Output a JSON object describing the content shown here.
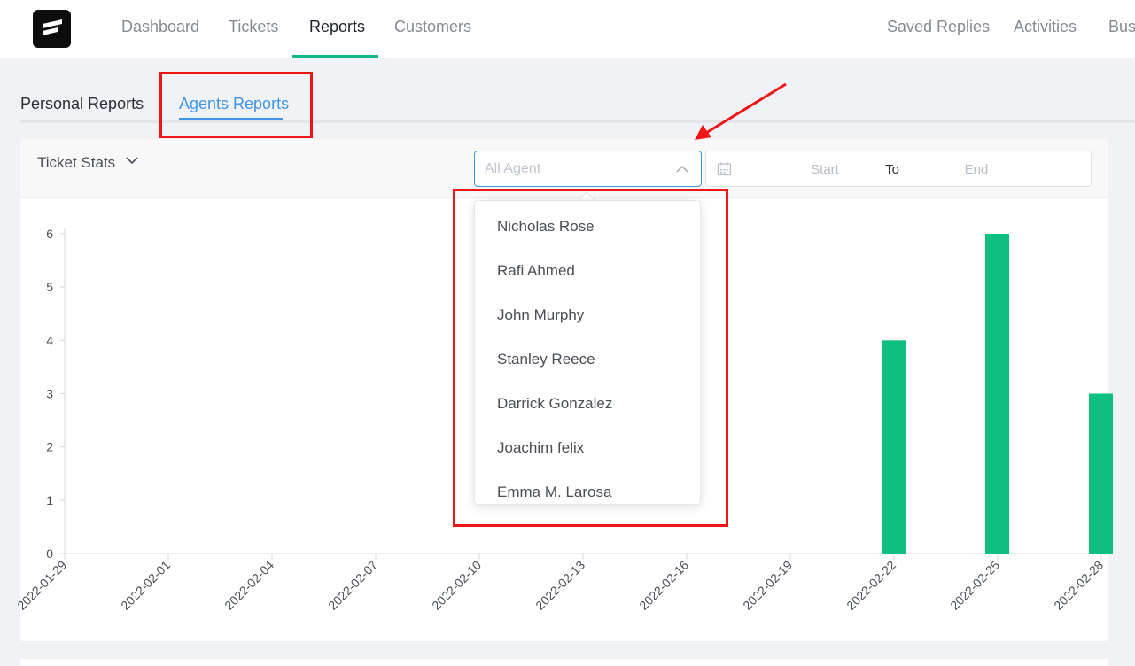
{
  "nav": {
    "items": [
      "Dashboard",
      "Tickets",
      "Reports",
      "Customers"
    ],
    "right_items": [
      "Saved Replies",
      "Activities",
      "Busi"
    ]
  },
  "subtabs": [
    "Personal Reports",
    "Agents Reports"
  ],
  "stats": {
    "label": "Ticket Stats"
  },
  "agent_select": {
    "placeholder": "All Agent"
  },
  "date_range": {
    "start": "Start",
    "separator": "To",
    "end": "End"
  },
  "dropdown": {
    "options": [
      "Nicholas Rose",
      "Rafi Ahmed",
      "John Murphy",
      "Stanley Reece",
      "Darrick Gonzalez",
      "Joachim felix",
      "Emma M. Larosa"
    ]
  },
  "colors": {
    "bar": "#0fbf80",
    "accent": "#3f94e3",
    "nav_active": "#16b98a",
    "highlight": "#f11616"
  },
  "chart_data": {
    "type": "bar",
    "categories": [
      "2022-01-29",
      "2022-01-30",
      "2022-01-31",
      "2022-02-01",
      "2022-02-02",
      "2022-02-03",
      "2022-02-04",
      "2022-02-05",
      "2022-02-06",
      "2022-02-07",
      "2022-02-08",
      "2022-02-09",
      "2022-02-10",
      "2022-02-11",
      "2022-02-12",
      "2022-02-13",
      "2022-02-14",
      "2022-02-15",
      "2022-02-16",
      "2022-02-17",
      "2022-02-18",
      "2022-02-19",
      "2022-02-20",
      "2022-02-21",
      "2022-02-22",
      "2022-02-23",
      "2022-02-24",
      "2022-02-25",
      "2022-02-26",
      "2022-02-27",
      "2022-02-28"
    ],
    "values": [
      0,
      0,
      0,
      0,
      0,
      0,
      0,
      0,
      0,
      0,
      0,
      0,
      0,
      0,
      0,
      0,
      0,
      0,
      0,
      0,
      0,
      0,
      0,
      0,
      4,
      0,
      0,
      6,
      0,
      0,
      3
    ],
    "tick_labels": [
      "2022-01-29",
      "2022-02-01",
      "2022-02-04",
      "2022-02-07",
      "2022-02-10",
      "2022-02-13",
      "2022-02-16",
      "2022-02-19",
      "2022-02-22",
      "2022-02-25",
      "2022-02-28"
    ],
    "y_ticks": [
      0,
      1,
      2,
      3,
      4,
      5,
      6
    ],
    "ylim": [
      0,
      6
    ],
    "grid": false,
    "legend": "none"
  }
}
